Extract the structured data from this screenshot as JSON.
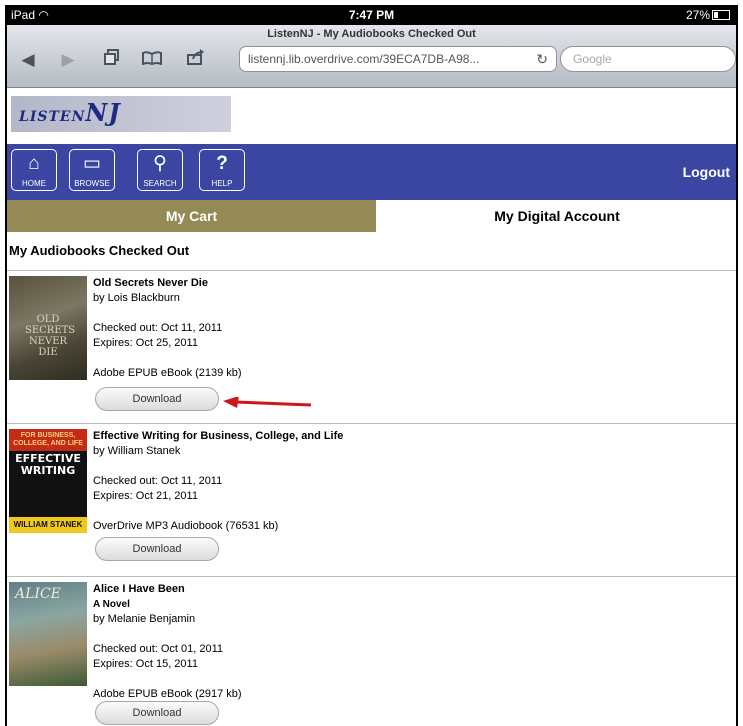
{
  "status_bar": {
    "device": "iPad",
    "time": "7:47 PM",
    "battery": "27%"
  },
  "browser": {
    "page_title": "ListenNJ - My Audiobooks Checked Out",
    "url": "listennj.lib.overdrive.com/39ECA7DB-A98...",
    "search_placeholder": "Google"
  },
  "site": {
    "logo_text": "LISTEN",
    "logo_text_2": "NJ",
    "menu": [
      {
        "label": "HOME",
        "icon": "home-icon"
      },
      {
        "label": "BROWSE",
        "icon": "book-icon"
      },
      {
        "label": "SEARCH",
        "icon": "search-icon"
      },
      {
        "label": "HELP",
        "icon": "help-icon"
      }
    ],
    "logout": "Logout",
    "tabs": {
      "cart": "My Cart",
      "account": "My Digital Account"
    },
    "heading": "My Audiobooks Checked Out"
  },
  "books": [
    {
      "title": "Old Secrets Never Die",
      "author": "by Lois Blackburn",
      "checked_out": "Checked out: Oct 11, 2011",
      "expires": "Expires: Oct 25, 2011",
      "format": "Adobe EPUB eBook (2139 kb)",
      "button": "Download",
      "cover_text": "OLD SECRETS NEVER DIE"
    },
    {
      "title": "Effective Writing for Business, College, and Life",
      "author": "by William Stanek",
      "checked_out": "Checked out: Oct 11, 2011",
      "expires": "Expires: Oct 21, 2011",
      "format": "OverDrive MP3 Audiobook (76531 kb)",
      "button": "Download",
      "cover_top": "FOR BUSINESS, COLLEGE, AND LIFE",
      "cover_mid": "EFFECTIVE WRITING",
      "cover_bottom": "WILLIAM STANEK"
    },
    {
      "title": "Alice I Have Been",
      "subtitle": "A Novel",
      "author": "by Melanie Benjamin",
      "checked_out": "Checked out: Oct 01, 2011",
      "expires": "Expires: Oct 15, 2011",
      "format": "Adobe EPUB eBook (2917 kb)",
      "button": "Download",
      "cover_text": "ALICE"
    }
  ],
  "colors": {
    "menu_bar": "#3a46a2",
    "cart_tab": "#938a56",
    "arrow": "#d0141b"
  }
}
